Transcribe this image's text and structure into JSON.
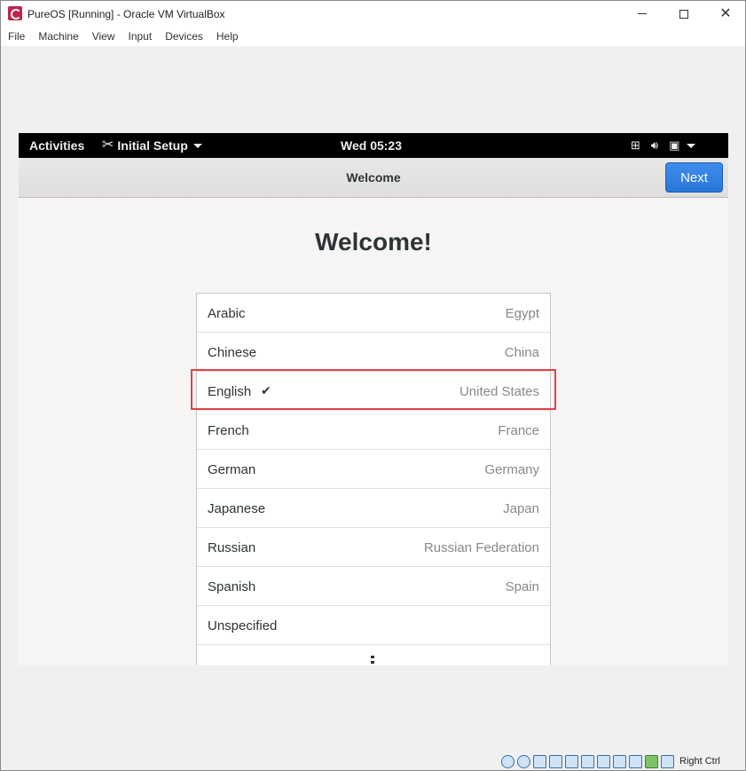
{
  "window": {
    "title": "PureOS [Running] - Oracle VM VirtualBox",
    "controls": {
      "minimize": "–",
      "maximize": "□",
      "close": "✕"
    }
  },
  "menubar": {
    "items": [
      "File",
      "Machine",
      "View",
      "Input",
      "Devices",
      "Help"
    ]
  },
  "gnome_topbar": {
    "activities": "Activities",
    "app_menu": "Initial Setup",
    "clock": "Wed 05:23",
    "status_icons": [
      "network-icon",
      "volume-icon",
      "power-icon",
      "caret-down-icon"
    ]
  },
  "headerbar": {
    "title": "Welcome",
    "next_label": "Next",
    "accent_color": "#3584e4"
  },
  "main": {
    "heading": "Welcome!",
    "languages": [
      {
        "language": "Arabic",
        "region": "Egypt",
        "selected": false
      },
      {
        "language": "Chinese",
        "region": "China",
        "selected": false
      },
      {
        "language": "English",
        "region": "United States",
        "selected": true
      },
      {
        "language": "French",
        "region": "France",
        "selected": false
      },
      {
        "language": "German",
        "region": "Germany",
        "selected": false
      },
      {
        "language": "Japanese",
        "region": "Japan",
        "selected": false
      },
      {
        "language": "Russian",
        "region": "Russian Federation",
        "selected": false
      },
      {
        "language": "Spanish",
        "region": "Spain",
        "selected": false
      },
      {
        "language": "Unspecified",
        "region": "",
        "selected": false
      }
    ],
    "check_mark": "✔",
    "highlight_color": "#e0434b"
  },
  "statusbar": {
    "host_key": "Right Ctrl"
  }
}
